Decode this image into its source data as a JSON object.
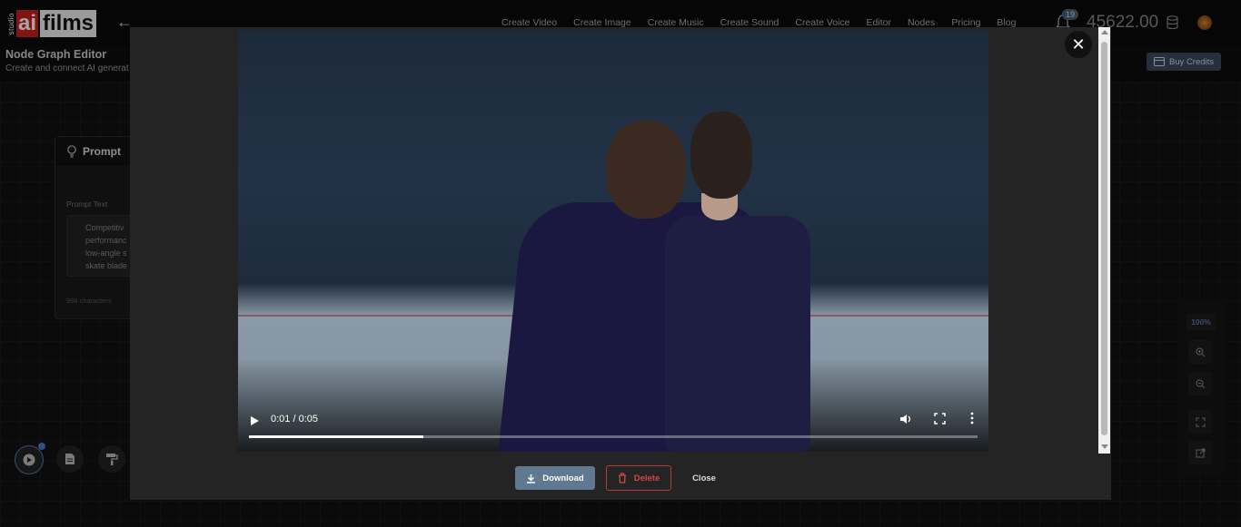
{
  "header": {
    "logo": {
      "studio": "studio",
      "ai": "ai",
      "films": "films"
    },
    "back_icon": "arrow-left-icon",
    "nav": [
      "Create Video",
      "Create Image",
      "Create Music",
      "Create Sound",
      "Create Voice",
      "Editor",
      "Nodes",
      "Pricing",
      "Blog"
    ],
    "notification_count": "19",
    "credits": "45622.00"
  },
  "page": {
    "title": "Node Graph Editor",
    "subtitle": "Create and connect AI generat",
    "buy_credits": "Buy Credits"
  },
  "node": {
    "title": "Prompt",
    "label": "Prompt Text",
    "text_lines": [
      "Competitiv",
      "performanc",
      "low-angle s",
      "skate blade"
    ],
    "char_count": "998 characters"
  },
  "zoom": {
    "level": "100%"
  },
  "video_modal": {
    "time_display": "0:01 / 0:05",
    "progress": 0.24,
    "download_label": "Download",
    "delete_label": "Delete",
    "close_label": "Close"
  }
}
